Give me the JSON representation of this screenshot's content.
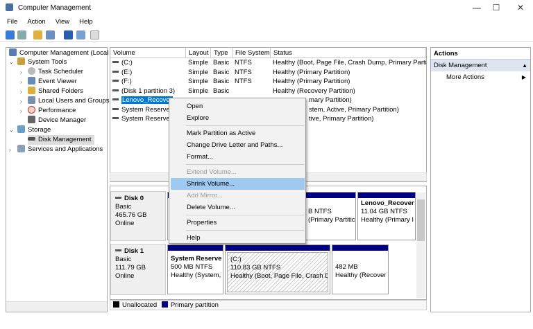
{
  "window": {
    "title": "Computer Management",
    "minimize": "—",
    "maximize": "☐",
    "close": "✕"
  },
  "menu": [
    "File",
    "Action",
    "View",
    "Help"
  ],
  "tree": [
    {
      "label": "Computer Management (Local",
      "icon": "computer-management-icon"
    },
    {
      "label": "System Tools",
      "icon": "tools-icon"
    },
    {
      "label": "Task Scheduler",
      "icon": "clock-icon"
    },
    {
      "label": "Event Viewer",
      "icon": "event-viewer-icon"
    },
    {
      "label": "Shared Folders",
      "icon": "shared-folder-icon"
    },
    {
      "label": "Local Users and Groups",
      "icon": "users-icon"
    },
    {
      "label": "Performance",
      "icon": "performance-icon"
    },
    {
      "label": "Device Manager",
      "icon": "device-manager-icon"
    },
    {
      "label": "Storage",
      "icon": "storage-icon"
    },
    {
      "label": "Disk Management",
      "icon": "disk-icon",
      "selected": true
    },
    {
      "label": "Services and Applications",
      "icon": "services-icon"
    }
  ],
  "volumes": {
    "columns": [
      "Volume",
      "Layout",
      "Type",
      "File System",
      "Status"
    ],
    "rows": [
      [
        "(C:)",
        "Simple",
        "Basic",
        "NTFS",
        "Healthy (Boot, Page File, Crash Dump, Primary Partitic"
      ],
      [
        "(E:)",
        "Simple",
        "Basic",
        "NTFS",
        "Healthy (Primary Partition)"
      ],
      [
        "(F:)",
        "Simple",
        "Basic",
        "NTFS",
        "Healthy (Primary Partition)"
      ],
      [
        "(Disk 1 partition 3)",
        "Simple",
        "Basic",
        "",
        "Healthy (Recovery Partition)"
      ],
      [
        "Lenovo_Recover",
        "",
        "",
        "",
        "mary Partition)"
      ],
      [
        "System Reserved",
        "",
        "",
        "",
        "stem, Active, Primary Partition)"
      ],
      [
        "System Reserved",
        "",
        "",
        "",
        "tive, Primary Partition)"
      ]
    ]
  },
  "disks": [
    {
      "name": "Disk 0",
      "type": "Basic",
      "size": "465.76 GB",
      "state": "Online",
      "partitions": [
        {
          "l1": "",
          "l2": "",
          "l3": ""
        },
        {
          "l1": "",
          "l2": "B NTFS",
          "l3": "(Primary Partitic"
        },
        {
          "l1": "Lenovo_Recover",
          "l2": "11.04 GB NTFS",
          "l3": "Healthy (Primary I"
        }
      ]
    },
    {
      "name": "Disk 1",
      "type": "Basic",
      "size": "111.79 GB",
      "state": "Online",
      "partitions": [
        {
          "l1": "System Reserve",
          "l2": "500 MB NTFS",
          "l3": "Healthy (System,"
        },
        {
          "l1": "(C:)",
          "l2": "110.83 GB NTFS",
          "l3": "Healthy (Boot, Page File, Crash Dur"
        },
        {
          "l1": "",
          "l2": "482 MB",
          "l3": "Healthy (Recover"
        }
      ]
    }
  ],
  "legend": {
    "unallocated": "Unallocated",
    "primary": "Primary partition",
    "colors": {
      "unallocated": "#000000",
      "primary": "#000080"
    }
  },
  "actions": {
    "title": "Actions",
    "section": "Disk Management",
    "more": "More Actions"
  },
  "context_menu": [
    {
      "label": "Open"
    },
    {
      "label": "Explore"
    },
    {
      "sep": true
    },
    {
      "label": "Mark Partition as Active"
    },
    {
      "label": "Change Drive Letter and Paths..."
    },
    {
      "label": "Format..."
    },
    {
      "sep": true
    },
    {
      "label": "Extend Volume...",
      "disabled": true
    },
    {
      "label": "Shrink Volume...",
      "highlighted": true
    },
    {
      "label": "Add Mirror...",
      "disabled": true
    },
    {
      "label": "Delete Volume..."
    },
    {
      "sep": true
    },
    {
      "label": "Properties"
    },
    {
      "sep": true
    },
    {
      "label": "Help"
    }
  ],
  "accent": "#000080"
}
